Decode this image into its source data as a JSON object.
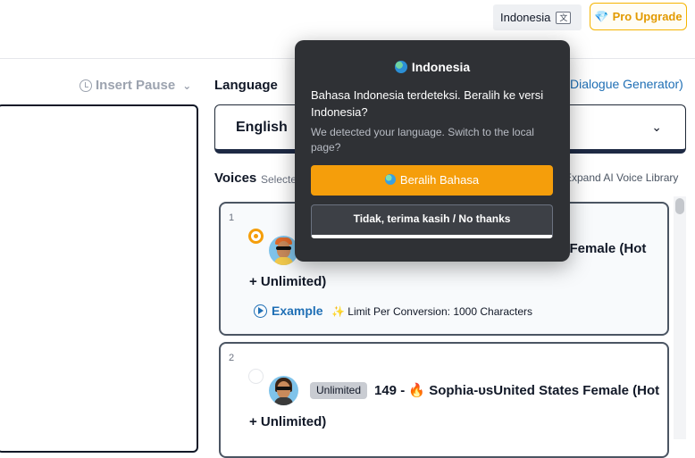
{
  "header": {
    "language_button": "Indonesia",
    "pro_button": "Pro Upgrade"
  },
  "editor": {
    "insert_pause": "Insert Pause"
  },
  "language": {
    "label": "Language",
    "selected": "English",
    "dialogue_link": "Dialogue Generator)"
  },
  "voices": {
    "label": "Voices",
    "subtext": "Selecte",
    "expand_link": "Expand AI Voice Library",
    "items": [
      {
        "number": "1",
        "title_visible": "s Female (Hot",
        "title_cont": "+ Unlimited)",
        "example_label": "Example",
        "limit_text": "Limit Per Conversion: 1000 Characters"
      },
      {
        "number": "2",
        "badge": "Unlimited",
        "title": "149 - 🔥 Sophia-ᴜsUnited States Female (Hot",
        "title_cont": "+ Unlimited)"
      }
    ]
  },
  "popup": {
    "title": "Indonesia",
    "message": "Bahasa Indonesia terdeteksi. Beralih ke versi Indonesia?",
    "submessage": "We detected your language. Switch to the local page?",
    "primary_button": "Beralih Bahasa",
    "secondary_button": "Tidak, terima kasih / No thanks"
  },
  "colors": {
    "accent": "#f59e0b",
    "link": "#1f6fb5",
    "popup_bg": "#2f3135"
  }
}
